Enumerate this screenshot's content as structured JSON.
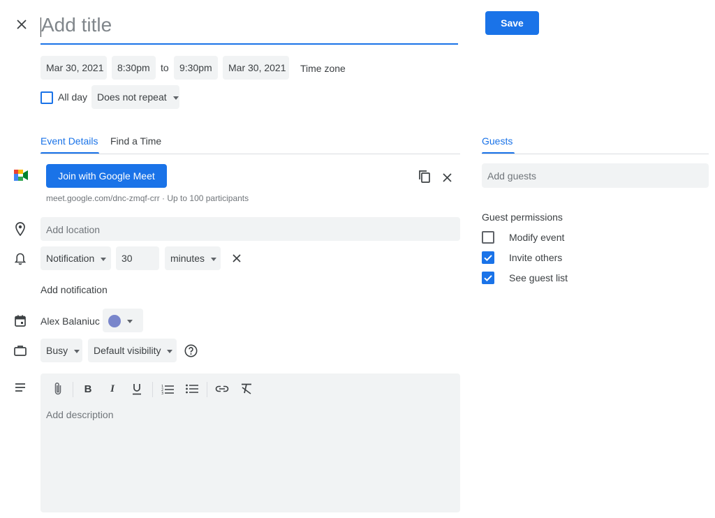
{
  "header": {
    "title_placeholder": "Add title",
    "save_label": "Save"
  },
  "datetime": {
    "start_date": "Mar 30, 2021",
    "start_time": "8:30pm",
    "to_label": "to",
    "end_time": "9:30pm",
    "end_date": "Mar 30, 2021",
    "timezone_label": "Time zone",
    "all_day_label": "All day",
    "repeat_value": "Does not repeat"
  },
  "tabs": {
    "event_details": "Event Details",
    "find_a_time": "Find a Time",
    "guests": "Guests"
  },
  "meet": {
    "join_label": "Join with Google Meet",
    "link_text": "meet.google.com/dnc-zmqf-crr · Up to 100 participants"
  },
  "location": {
    "placeholder": "Add location"
  },
  "notification": {
    "type_value": "Notification",
    "amount_value": "30",
    "unit_value": "minutes",
    "add_label": "Add notification"
  },
  "calendar": {
    "owner_name": "Alex Balaniuc",
    "color": "#7986cb"
  },
  "availability": {
    "busy_value": "Busy",
    "visibility_value": "Default visibility"
  },
  "description": {
    "placeholder": "Add description"
  },
  "guests": {
    "add_placeholder": "Add guests",
    "permissions_title": "Guest permissions",
    "permissions": [
      {
        "label": "Modify event",
        "checked": false
      },
      {
        "label": "Invite others",
        "checked": true
      },
      {
        "label": "See guest list",
        "checked": true
      }
    ]
  },
  "colors": {
    "accent": "#1a73e8",
    "field_bg": "#f1f3f4",
    "text": "#3c4043"
  }
}
